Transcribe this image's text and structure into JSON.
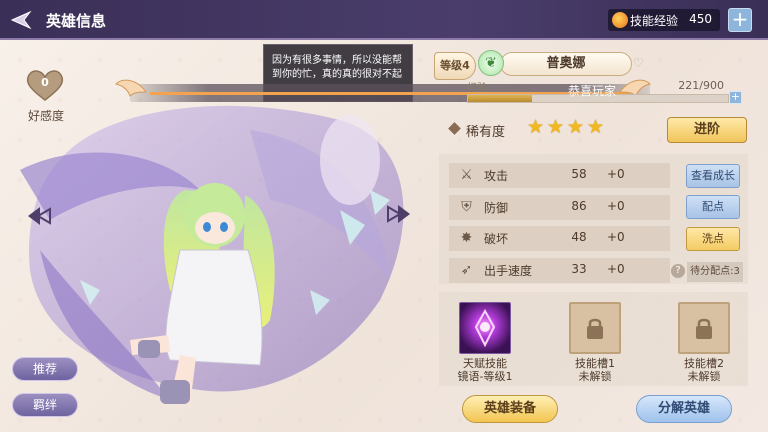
{
  "header": {
    "title": "英雄信息",
    "skill_exp_label": "技能经验",
    "skill_exp_value": "450",
    "plus": "+"
  },
  "favor": {
    "value": "0",
    "label": "好感度"
  },
  "tooltip": {
    "text": "因为有很多事情，所以没能帮到你的忙，真的真的很对不起"
  },
  "hero": {
    "level_label": "等级4",
    "name": "普奥娜",
    "element_icon": "leaf-icon",
    "exp_label": "经验",
    "exp_value": "221/900",
    "exp_fraction": 0.2456,
    "exp_flash": "恭喜玩家",
    "exp_plus": "+"
  },
  "rarity": {
    "label": "稀有度",
    "stars": 4
  },
  "buttons": {
    "advance": "进阶",
    "view_growth": "查看成长",
    "allocate": "配点",
    "reset": "洗点",
    "recommend": "推荐",
    "bond": "羁绊",
    "equipment": "英雄装备",
    "decompose": "分解英雄"
  },
  "stats": [
    {
      "icon": "crossed-swords-icon",
      "name": "攻击",
      "value": "58",
      "bonus": "+0"
    },
    {
      "icon": "shield-icon",
      "name": "防御",
      "value": "86",
      "bonus": "+0"
    },
    {
      "icon": "burst-icon",
      "name": "破坏",
      "value": "48",
      "bonus": "+0"
    },
    {
      "icon": "speed-icon",
      "name": "出手速度",
      "value": "33",
      "bonus": "+0"
    }
  ],
  "pending_points": "待分配点:3",
  "skills": [
    {
      "line1": "天赋技能",
      "line2": "镜语-等级1"
    },
    {
      "line1": "技能槽1",
      "line2": "未解锁"
    },
    {
      "line1": "技能槽2",
      "line2": "未解锁"
    }
  ],
  "colors": {
    "header": "#3a2f56",
    "gold": "#f2c550",
    "blue": "#9fc2ec",
    "star": "#f2b821"
  }
}
